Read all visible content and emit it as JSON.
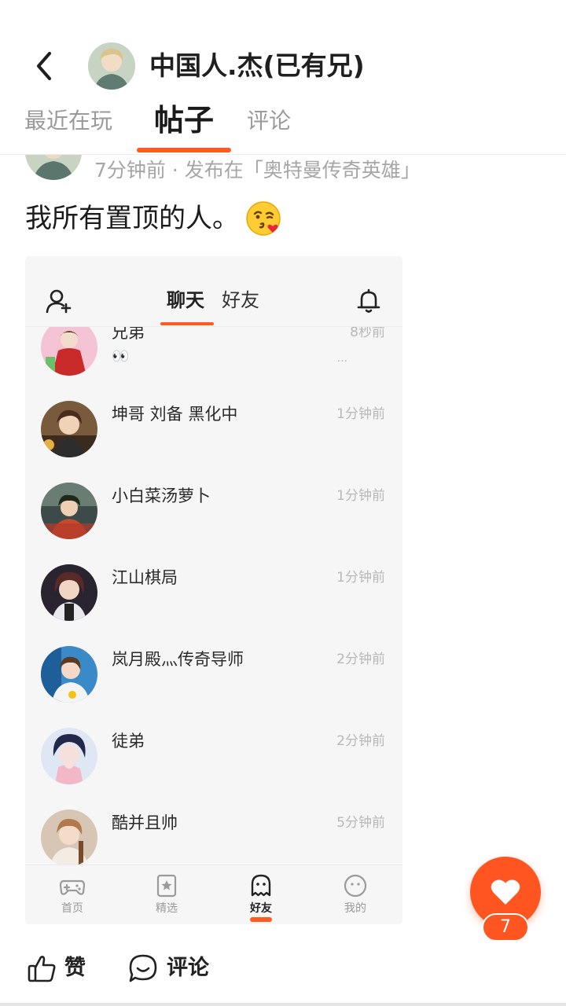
{
  "header": {
    "username": "中国人.杰(已有兄)",
    "back_icon": "chevron-left-icon"
  },
  "tabs": [
    {
      "label": "最近在玩",
      "active": false
    },
    {
      "label": "帖子",
      "active": true
    },
    {
      "label": "评论",
      "active": false
    }
  ],
  "post": {
    "meta": "7分钟前 · 发布在「奥特曼传奇英雄」",
    "text": "我所有置顶的人。",
    "emoji": "kissing-face-with-heart-emoji"
  },
  "screenshot": {
    "tabs": {
      "chat": "聊天",
      "friends": "好友"
    },
    "chats": [
      {
        "name": "兄弟",
        "time": "8秒前",
        "message": "👀",
        "more": "..."
      },
      {
        "name": "坤哥 刘备 黑化中",
        "time": "1分钟前"
      },
      {
        "name": "小白菜汤萝卜",
        "time": "1分钟前"
      },
      {
        "name": "江山棋局",
        "time": "1分钟前"
      },
      {
        "name": "岚月殿灬传奇导师",
        "time": "2分钟前"
      },
      {
        "name": "徒弟",
        "time": "2分钟前"
      },
      {
        "name": "酷并且帅",
        "time": "5分钟前"
      }
    ],
    "nav": [
      {
        "label": "首页",
        "icon": "gamepad-icon"
      },
      {
        "label": "精选",
        "icon": "star-bookmark-icon"
      },
      {
        "label": "好友",
        "icon": "ghost-icon",
        "active": true
      },
      {
        "label": "我的",
        "icon": "face-icon"
      }
    ]
  },
  "like_fab": {
    "count": "7"
  },
  "actions": {
    "like_label": "赞",
    "comment_label": "评论"
  },
  "colors": {
    "accent": "#ff5521",
    "muted_text": "#a6a6a6"
  }
}
